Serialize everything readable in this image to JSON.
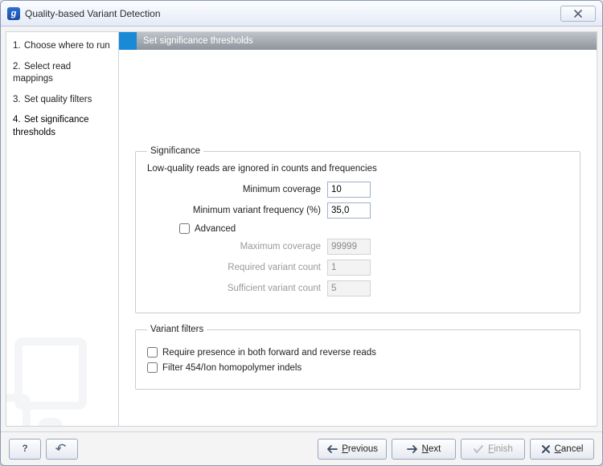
{
  "window": {
    "title": "Quality-based Variant Detection",
    "app_icon_glyph": "g"
  },
  "sidebar": {
    "steps": [
      {
        "num": "1.",
        "label": "Choose where to run"
      },
      {
        "num": "2.",
        "label": "Select read mappings"
      },
      {
        "num": "3.",
        "label": "Set quality filters"
      },
      {
        "num": "4.",
        "label": "Set significance thresholds"
      }
    ],
    "active_index": 3
  },
  "step_header": {
    "title": "Set significance thresholds"
  },
  "significance": {
    "legend": "Significance",
    "note": "Low-quality reads are ignored in counts and frequencies",
    "min_coverage_label": "Minimum coverage",
    "min_coverage_value": "10",
    "min_freq_label": "Minimum variant frequency (%)",
    "min_freq_value": "35,0",
    "advanced_label": "Advanced",
    "advanced_checked": false,
    "max_coverage_label": "Maximum coverage",
    "max_coverage_value": "99999",
    "req_variant_label": "Required variant count",
    "req_variant_value": "1",
    "suf_variant_label": "Sufficient variant count",
    "suf_variant_value": "5"
  },
  "variant_filters": {
    "legend": "Variant filters",
    "require_presence_label": "Require presence in both forward and reverse reads",
    "require_presence_checked": false,
    "filter_hp_label": "Filter 454/Ion homopolymer indels",
    "filter_hp_checked": false
  },
  "buttons": {
    "help": "?",
    "previous": "Previous",
    "next": "Next",
    "finish": "Finish",
    "cancel": "Cancel"
  }
}
